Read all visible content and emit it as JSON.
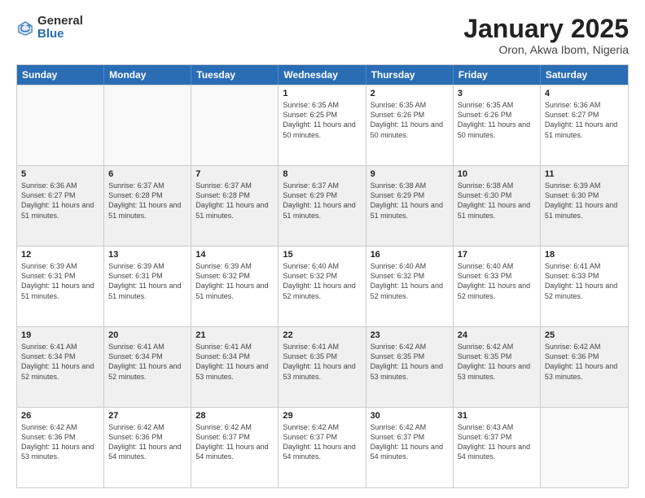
{
  "logo": {
    "general": "General",
    "blue": "Blue"
  },
  "title": "January 2025",
  "location": "Oron, Akwa Ibom, Nigeria",
  "days": [
    "Sunday",
    "Monday",
    "Tuesday",
    "Wednesday",
    "Thursday",
    "Friday",
    "Saturday"
  ],
  "weeks": [
    [
      {
        "day": "",
        "sunrise": "",
        "sunset": "",
        "daylight": "",
        "empty": true
      },
      {
        "day": "",
        "sunrise": "",
        "sunset": "",
        "daylight": "",
        "empty": true
      },
      {
        "day": "",
        "sunrise": "",
        "sunset": "",
        "daylight": "",
        "empty": true
      },
      {
        "day": "1",
        "sunrise": "Sunrise: 6:35 AM",
        "sunset": "Sunset: 6:25 PM",
        "daylight": "Daylight: 11 hours and 50 minutes.",
        "empty": false
      },
      {
        "day": "2",
        "sunrise": "Sunrise: 6:35 AM",
        "sunset": "Sunset: 6:26 PM",
        "daylight": "Daylight: 11 hours and 50 minutes.",
        "empty": false
      },
      {
        "day": "3",
        "sunrise": "Sunrise: 6:35 AM",
        "sunset": "Sunset: 6:26 PM",
        "daylight": "Daylight: 11 hours and 50 minutes.",
        "empty": false
      },
      {
        "day": "4",
        "sunrise": "Sunrise: 6:36 AM",
        "sunset": "Sunset: 6:27 PM",
        "daylight": "Daylight: 11 hours and 51 minutes.",
        "empty": false
      }
    ],
    [
      {
        "day": "5",
        "sunrise": "Sunrise: 6:36 AM",
        "sunset": "Sunset: 6:27 PM",
        "daylight": "Daylight: 11 hours and 51 minutes.",
        "empty": false
      },
      {
        "day": "6",
        "sunrise": "Sunrise: 6:37 AM",
        "sunset": "Sunset: 6:28 PM",
        "daylight": "Daylight: 11 hours and 51 minutes.",
        "empty": false
      },
      {
        "day": "7",
        "sunrise": "Sunrise: 6:37 AM",
        "sunset": "Sunset: 6:28 PM",
        "daylight": "Daylight: 11 hours and 51 minutes.",
        "empty": false
      },
      {
        "day": "8",
        "sunrise": "Sunrise: 6:37 AM",
        "sunset": "Sunset: 6:29 PM",
        "daylight": "Daylight: 11 hours and 51 minutes.",
        "empty": false
      },
      {
        "day": "9",
        "sunrise": "Sunrise: 6:38 AM",
        "sunset": "Sunset: 6:29 PM",
        "daylight": "Daylight: 11 hours and 51 minutes.",
        "empty": false
      },
      {
        "day": "10",
        "sunrise": "Sunrise: 6:38 AM",
        "sunset": "Sunset: 6:30 PM",
        "daylight": "Daylight: 11 hours and 51 minutes.",
        "empty": false
      },
      {
        "day": "11",
        "sunrise": "Sunrise: 6:39 AM",
        "sunset": "Sunset: 6:30 PM",
        "daylight": "Daylight: 11 hours and 51 minutes.",
        "empty": false
      }
    ],
    [
      {
        "day": "12",
        "sunrise": "Sunrise: 6:39 AM",
        "sunset": "Sunset: 6:31 PM",
        "daylight": "Daylight: 11 hours and 51 minutes.",
        "empty": false
      },
      {
        "day": "13",
        "sunrise": "Sunrise: 6:39 AM",
        "sunset": "Sunset: 6:31 PM",
        "daylight": "Daylight: 11 hours and 51 minutes.",
        "empty": false
      },
      {
        "day": "14",
        "sunrise": "Sunrise: 6:39 AM",
        "sunset": "Sunset: 6:32 PM",
        "daylight": "Daylight: 11 hours and 51 minutes.",
        "empty": false
      },
      {
        "day": "15",
        "sunrise": "Sunrise: 6:40 AM",
        "sunset": "Sunset: 6:32 PM",
        "daylight": "Daylight: 11 hours and 52 minutes.",
        "empty": false
      },
      {
        "day": "16",
        "sunrise": "Sunrise: 6:40 AM",
        "sunset": "Sunset: 6:32 PM",
        "daylight": "Daylight: 11 hours and 52 minutes.",
        "empty": false
      },
      {
        "day": "17",
        "sunrise": "Sunrise: 6:40 AM",
        "sunset": "Sunset: 6:33 PM",
        "daylight": "Daylight: 11 hours and 52 minutes.",
        "empty": false
      },
      {
        "day": "18",
        "sunrise": "Sunrise: 6:41 AM",
        "sunset": "Sunset: 6:33 PM",
        "daylight": "Daylight: 11 hours and 52 minutes.",
        "empty": false
      }
    ],
    [
      {
        "day": "19",
        "sunrise": "Sunrise: 6:41 AM",
        "sunset": "Sunset: 6:34 PM",
        "daylight": "Daylight: 11 hours and 52 minutes.",
        "empty": false
      },
      {
        "day": "20",
        "sunrise": "Sunrise: 6:41 AM",
        "sunset": "Sunset: 6:34 PM",
        "daylight": "Daylight: 11 hours and 52 minutes.",
        "empty": false
      },
      {
        "day": "21",
        "sunrise": "Sunrise: 6:41 AM",
        "sunset": "Sunset: 6:34 PM",
        "daylight": "Daylight: 11 hours and 53 minutes.",
        "empty": false
      },
      {
        "day": "22",
        "sunrise": "Sunrise: 6:41 AM",
        "sunset": "Sunset: 6:35 PM",
        "daylight": "Daylight: 11 hours and 53 minutes.",
        "empty": false
      },
      {
        "day": "23",
        "sunrise": "Sunrise: 6:42 AM",
        "sunset": "Sunset: 6:35 PM",
        "daylight": "Daylight: 11 hours and 53 minutes.",
        "empty": false
      },
      {
        "day": "24",
        "sunrise": "Sunrise: 6:42 AM",
        "sunset": "Sunset: 6:35 PM",
        "daylight": "Daylight: 11 hours and 53 minutes.",
        "empty": false
      },
      {
        "day": "25",
        "sunrise": "Sunrise: 6:42 AM",
        "sunset": "Sunset: 6:36 PM",
        "daylight": "Daylight: 11 hours and 53 minutes.",
        "empty": false
      }
    ],
    [
      {
        "day": "26",
        "sunrise": "Sunrise: 6:42 AM",
        "sunset": "Sunset: 6:36 PM",
        "daylight": "Daylight: 11 hours and 53 minutes.",
        "empty": false
      },
      {
        "day": "27",
        "sunrise": "Sunrise: 6:42 AM",
        "sunset": "Sunset: 6:36 PM",
        "daylight": "Daylight: 11 hours and 54 minutes.",
        "empty": false
      },
      {
        "day": "28",
        "sunrise": "Sunrise: 6:42 AM",
        "sunset": "Sunset: 6:37 PM",
        "daylight": "Daylight: 11 hours and 54 minutes.",
        "empty": false
      },
      {
        "day": "29",
        "sunrise": "Sunrise: 6:42 AM",
        "sunset": "Sunset: 6:37 PM",
        "daylight": "Daylight: 11 hours and 54 minutes.",
        "empty": false
      },
      {
        "day": "30",
        "sunrise": "Sunrise: 6:42 AM",
        "sunset": "Sunset: 6:37 PM",
        "daylight": "Daylight: 11 hours and 54 minutes.",
        "empty": false
      },
      {
        "day": "31",
        "sunrise": "Sunrise: 6:43 AM",
        "sunset": "Sunset: 6:37 PM",
        "daylight": "Daylight: 11 hours and 54 minutes.",
        "empty": false
      },
      {
        "day": "",
        "sunrise": "",
        "sunset": "",
        "daylight": "",
        "empty": true
      }
    ]
  ]
}
